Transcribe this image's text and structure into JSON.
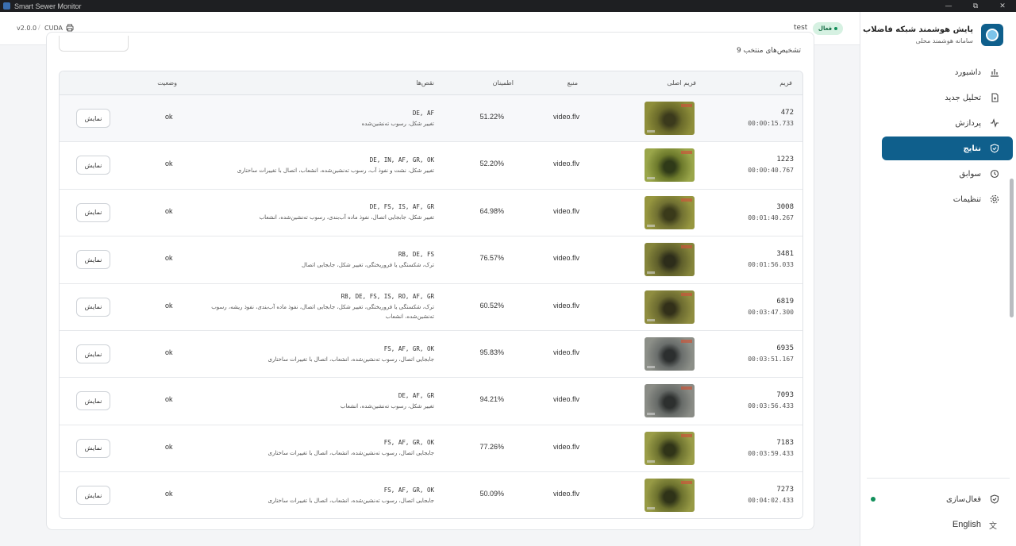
{
  "window": {
    "title": "Smart Sewer Monitor"
  },
  "header": {
    "version": "v2.0.0",
    "separator": "/",
    "device": "CUDA",
    "user": "test",
    "status": "فعال"
  },
  "sidebar": {
    "brand_title": "پایش هوشمند شبکه فاضلاب",
    "brand_subtitle": "سامانه هوشمند محلی",
    "items": [
      {
        "label": "داشبورد",
        "icon": "chart-icon"
      },
      {
        "label": "تحلیل جدید",
        "icon": "file-plus-icon"
      },
      {
        "label": "پردازش",
        "icon": "activity-icon"
      },
      {
        "label": "نتایج",
        "icon": "shield-icon"
      },
      {
        "label": "سوابق",
        "icon": "history-icon"
      },
      {
        "label": "تنظیمات",
        "icon": "gear-icon"
      }
    ],
    "activation_label": "فعال‌سازی",
    "language_label": "English"
  },
  "main": {
    "selected_count_text": "9 تشخیص‌های منتخب",
    "columns": {
      "frame": "فریم",
      "original_frame": "فریم اصلی",
      "source": "منبع",
      "confidence": "اطمینان",
      "defects": "نقص‌ها",
      "status": "وضعیت"
    },
    "show_label": "نمایش",
    "rows": [
      {
        "frame": "472",
        "time": "00:00:15.733",
        "source": "video.flv",
        "confidence": "51.22%",
        "codes": "DE, AF",
        "desc": "تغییر شکل، رسوب ته‌نشین‌شده",
        "status": "ok"
      },
      {
        "frame": "1223",
        "time": "00:00:40.767",
        "source": "video.flv",
        "confidence": "52.20%",
        "codes": "DE, IN, AF, GR, OK",
        "desc": "تغییر شکل، نشت و نفوذ آب، رسوب ته‌نشین‌شده، انشعاب، اتصال با تغییرات ساختاری",
        "status": "ok"
      },
      {
        "frame": "3008",
        "time": "00:01:40.267",
        "source": "video.flv",
        "confidence": "64.98%",
        "codes": "DE, FS, IS, AF, GR",
        "desc": "تغییر شکل، جابجایی اتصال، نفوذ ماده آب‌بندی، رسوب ته‌نشین‌شده، انشعاب",
        "status": "ok"
      },
      {
        "frame": "3481",
        "time": "00:01:56.033",
        "source": "video.flv",
        "confidence": "76.57%",
        "codes": "RB, DE, FS",
        "desc": "ترک، شکستگی یا فروریختگی، تغییر شکل، جابجایی اتصال",
        "status": "ok"
      },
      {
        "frame": "6819",
        "time": "00:03:47.300",
        "source": "video.flv",
        "confidence": "60.52%",
        "codes": "RB, DE, FS, IS, RO, AF, GR",
        "desc": "ترک، شکستگی یا فروریختگی، تغییر شکل، جابجایی اتصال، نفوذ ماده آب‌بندی، نفوذ ریشه، رسوب ته‌نشین‌شده، انشعاب",
        "status": "ok"
      },
      {
        "frame": "6935",
        "time": "00:03:51.167",
        "source": "video.flv",
        "confidence": "95.83%",
        "codes": "FS, AF, GR, OK",
        "desc": "جابجایی اتصال، رسوب ته‌نشین‌شده، انشعاب، اتصال با تغییرات ساختاری",
        "status": "ok"
      },
      {
        "frame": "7093",
        "time": "00:03:56.433",
        "source": "video.flv",
        "confidence": "94.21%",
        "codes": "DE, AF, GR",
        "desc": "تغییر شکل، رسوب ته‌نشین‌شده، انشعاب",
        "status": "ok"
      },
      {
        "frame": "7183",
        "time": "00:03:59.433",
        "source": "video.flv",
        "confidence": "77.26%",
        "codes": "FS, AF, GR, OK",
        "desc": "جابجایی اتصال، رسوب ته‌نشین‌شده، انشعاب، اتصال با تغییرات ساختاری",
        "status": "ok"
      },
      {
        "frame": "7273",
        "time": "00:04:02.433",
        "source": "video.flv",
        "confidence": "50.09%",
        "codes": "FS, AF, GR, OK",
        "desc": "جابجایی اتصال، رسوب ته‌نشین‌شده، انشعاب، اتصال با تغییرات ساختاری",
        "status": "ok"
      }
    ]
  },
  "colors": {
    "accent": "#0f5f8c",
    "active_green": "#128f5b",
    "pill_bg": "#d6f1e2"
  }
}
